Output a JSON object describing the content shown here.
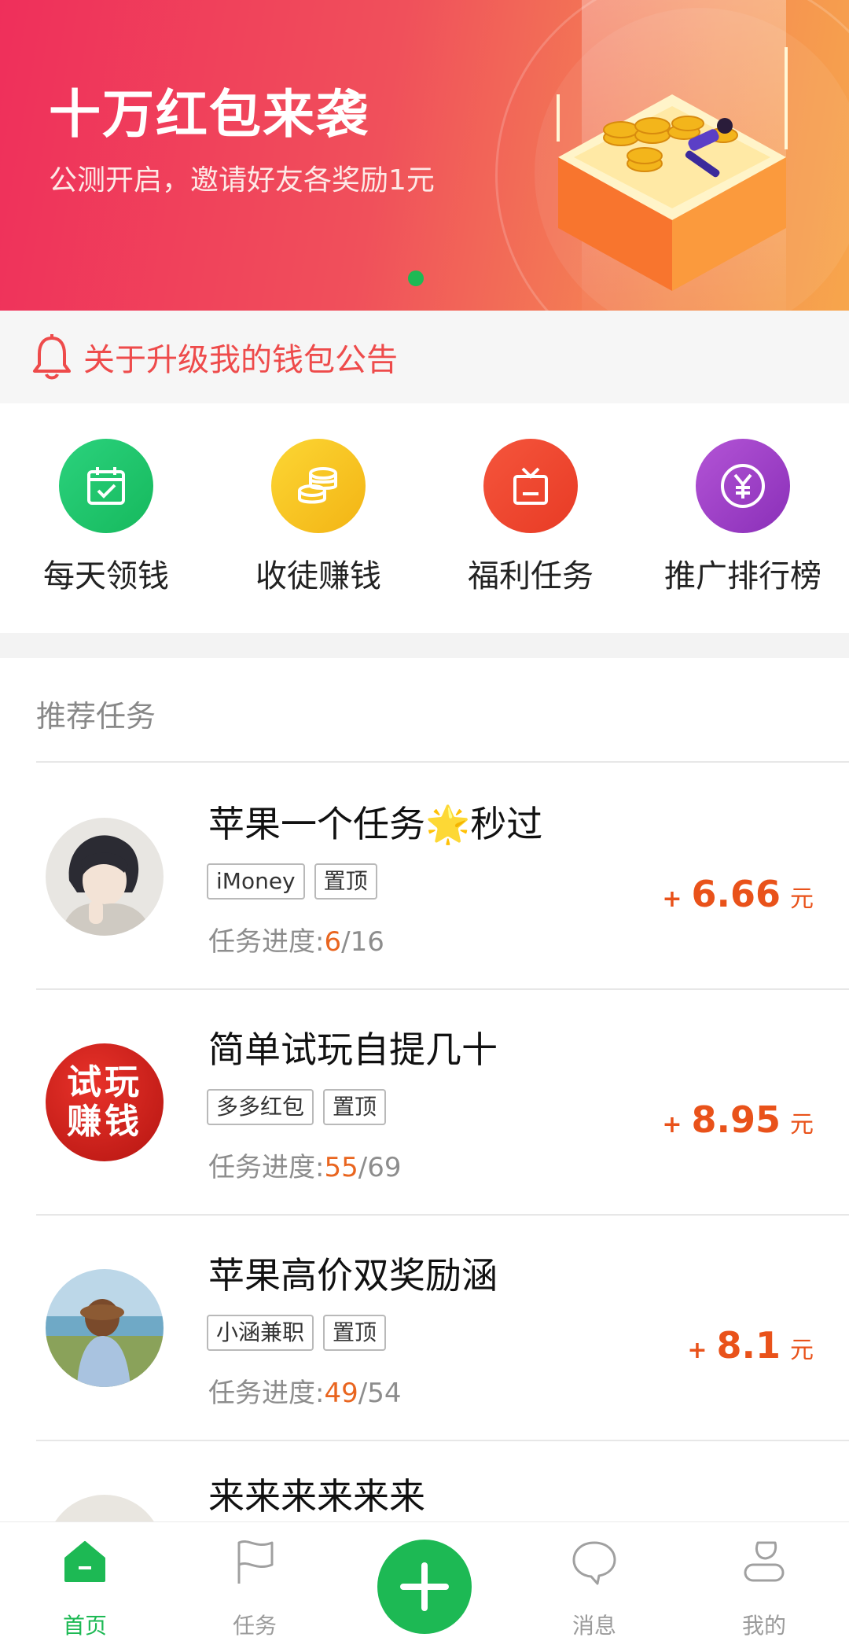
{
  "banner": {
    "title": "十万红包来袭",
    "subtitle": "公测开启，邀请好友各奖励1元"
  },
  "notice": {
    "text": "关于升级我的钱包公告",
    "icon": "bell-icon",
    "color": "#ee4b4b"
  },
  "menu": [
    {
      "label": "每天领钱",
      "icon": "calendar-check-icon",
      "color": "#1fc46a"
    },
    {
      "label": "收徒赚钱",
      "icon": "coin-stack-icon",
      "color": "#f6c21c"
    },
    {
      "label": "福利任务",
      "icon": "gift-box-icon",
      "color": "#f04a2f"
    },
    {
      "label": "推广排行榜",
      "icon": "yen-icon",
      "color": "#9b3fc6"
    }
  ],
  "section": {
    "title": "推荐任务"
  },
  "tasks": [
    {
      "title": "苹果一个任务🌟秒过",
      "tags": [
        "iMoney",
        "置顶"
      ],
      "progress_label": "任务进度:",
      "current": "6",
      "total": "/16",
      "plus": "+",
      "amount": "6.66",
      "unit": "元"
    },
    {
      "title": "简单试玩自提几十",
      "tags": [
        "多多红包",
        "置顶"
      ],
      "progress_label": "任务进度:",
      "current": "55",
      "total": "/69",
      "plus": "+",
      "amount": "8.95",
      "unit": "元",
      "avatar_text": [
        "试玩",
        "赚钱"
      ]
    },
    {
      "title": "苹果高价双奖励涵",
      "tags": [
        "小涵兼职",
        "置顶"
      ],
      "progress_label": "任务进度:",
      "current": "49",
      "total": "/54",
      "plus": "+",
      "amount": "8.1",
      "unit": "元"
    },
    {
      "title": "来来来来来来"
    }
  ],
  "nav": [
    {
      "label": "首页",
      "icon": "home-icon",
      "active": true
    },
    {
      "label": "任务",
      "icon": "flag-icon"
    },
    {
      "label": "",
      "icon": "plus-icon"
    },
    {
      "label": "消息",
      "icon": "chat-bubble-icon"
    },
    {
      "label": "我的",
      "icon": "user-icon"
    }
  ],
  "colors": {
    "accent": "#1db954",
    "reward": "#e9521a"
  }
}
